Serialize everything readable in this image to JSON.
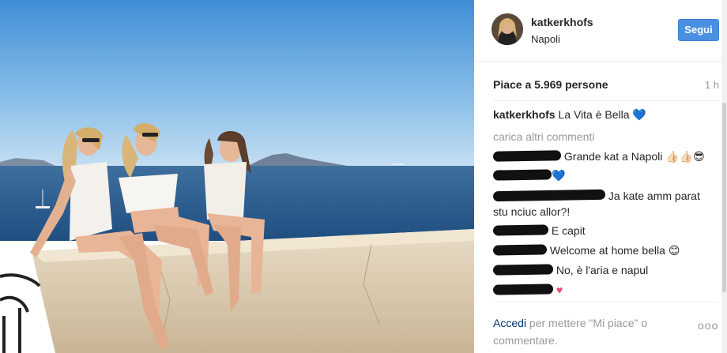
{
  "post": {
    "username": "katkerkhofs",
    "location": "Napoli",
    "follow_label": "Segui",
    "likes_text": "Piace a 5.969 persone",
    "time_ago": "1 h",
    "caption_user": "katkerkhofs",
    "caption_text": "La Vita è Bella",
    "caption_emoji": "💙",
    "load_more": "carica altri commenti"
  },
  "comments": [
    {
      "text": "Grande kat a Napoli",
      "emoji": "👍🏻👍🏻😎"
    },
    {
      "text": "",
      "emoji": "💙"
    },
    {
      "text": "Ja kate amm parat stu nciuc allor?!",
      "emoji": ""
    },
    {
      "text": "E capit",
      "emoji": ""
    },
    {
      "text": "Welcome at home bella",
      "emoji": "😊"
    },
    {
      "text": "No, è l'aria e napul",
      "emoji": ""
    },
    {
      "text": "",
      "emoji": "♥"
    }
  ],
  "footer": {
    "login_link": "Accedi",
    "login_rest": "per mettere \"Mi piace\" o commentare.",
    "more_icon": "ooo"
  },
  "colors": {
    "follow_button": "#4a90e2",
    "link": "#003569",
    "muted": "#999999"
  }
}
